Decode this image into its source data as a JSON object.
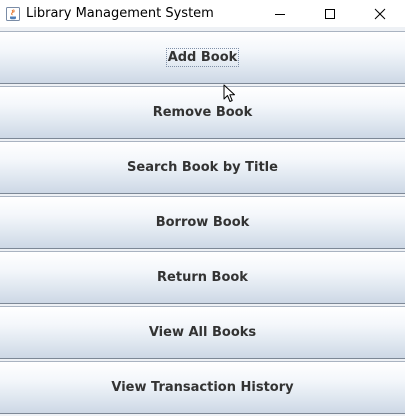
{
  "window": {
    "title": "Library Management System",
    "app_icon": "java-icon",
    "controls": [
      "minimize-icon",
      "maximize-icon",
      "close-icon"
    ]
  },
  "menu": {
    "buttons": [
      {
        "label": "Add Book",
        "focused": true
      },
      {
        "label": "Remove Book",
        "focused": false
      },
      {
        "label": "Search Book by Title",
        "focused": false
      },
      {
        "label": "Borrow Book",
        "focused": false
      },
      {
        "label": "Return Book",
        "focused": false
      },
      {
        "label": "View All Books",
        "focused": false
      },
      {
        "label": "View Transaction History",
        "focused": false
      }
    ]
  },
  "colors": {
    "button_border": "#7d8896",
    "button_text": "#333333",
    "titlebar_bg": "#ffffff"
  }
}
